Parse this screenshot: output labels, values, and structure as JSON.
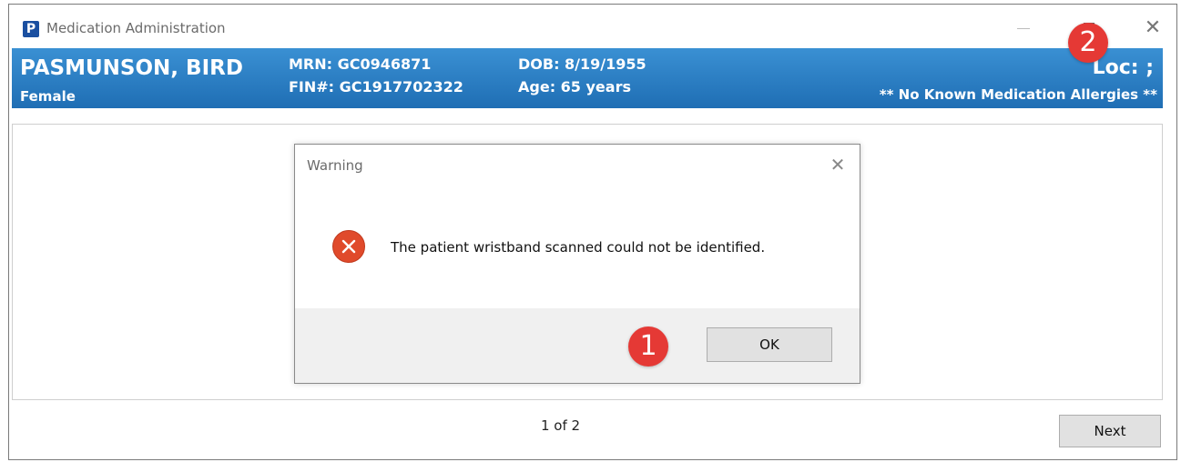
{
  "window": {
    "logo_letter": "P",
    "title": "Medication Administration",
    "close_glyph": "✕"
  },
  "banner": {
    "patient_name": "PASMUNSON, BIRD",
    "sex": "Female",
    "mrn": "MRN: GC0946871",
    "fin": "FIN#: GC1917702322",
    "dob": "DOB: 8/19/1955",
    "age": "Age: 65 years",
    "location": "Loc: ;",
    "allergies": "** No Known Medication Allergies **"
  },
  "dialog": {
    "title": "Warning",
    "close_glyph": "✕",
    "message": "The patient wristband scanned could not be identified.",
    "ok_label": "OK"
  },
  "footer": {
    "page_indicator": "1 of 2",
    "next_label": "Next"
  },
  "markers": {
    "one": "1",
    "two": "2"
  },
  "colors": {
    "banner": "#2a7fc6",
    "error": "#e04a2b",
    "marker": "#e53935"
  },
  "icons": {
    "app": "app-logo-icon",
    "error": "error-icon",
    "close": "close-icon"
  }
}
